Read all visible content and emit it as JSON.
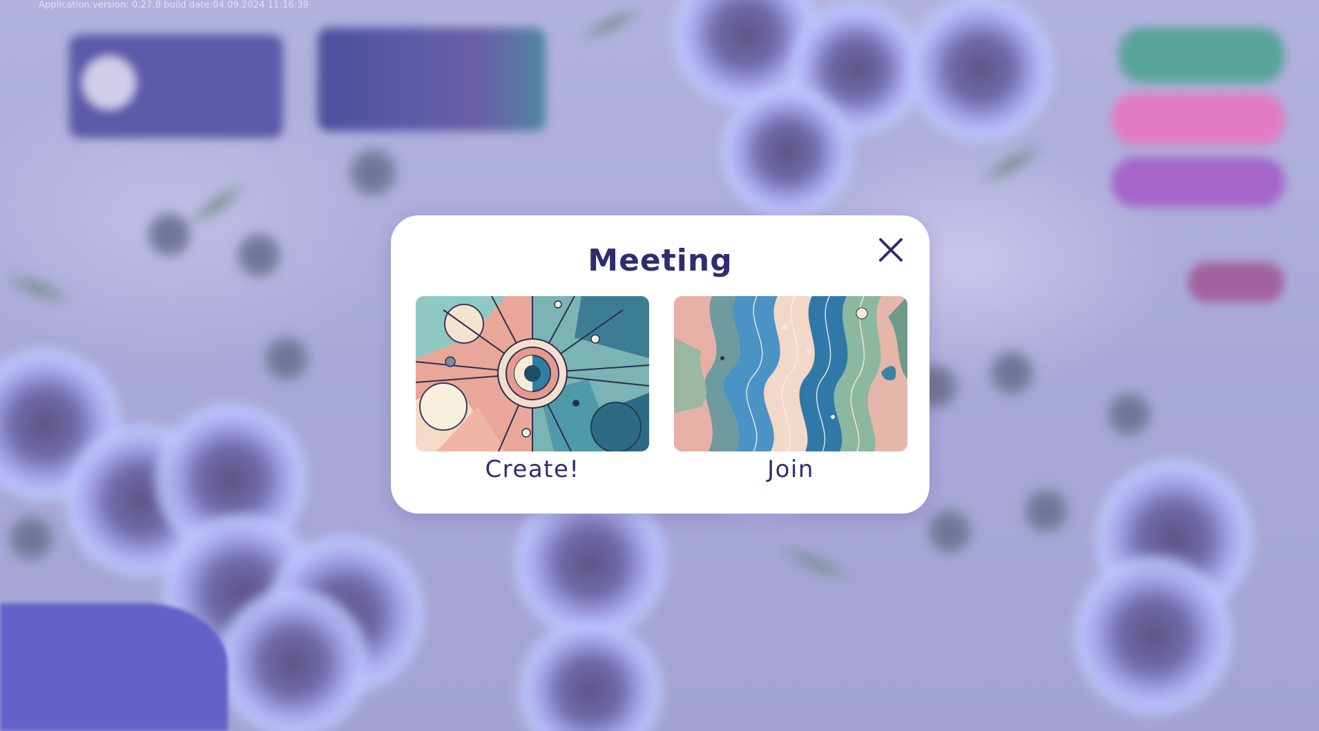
{
  "app": {
    "version_text": "Application.version: 0.27.8 build date:04.09.2024 11:16:39"
  },
  "modal": {
    "title": "Meeting",
    "close_icon": "close-icon",
    "options": [
      {
        "label": "Create!",
        "image": "abstract-radial-art"
      },
      {
        "label": "Join",
        "image": "abstract-wave-art"
      }
    ]
  },
  "colors": {
    "accent": "#2f2c70",
    "background": "#aaa9d8",
    "overlay_corner": "#6461c9",
    "pill_green": "#5aa39a",
    "pill_pink": "#e27bc0",
    "pill_purple": "#a565c9"
  }
}
